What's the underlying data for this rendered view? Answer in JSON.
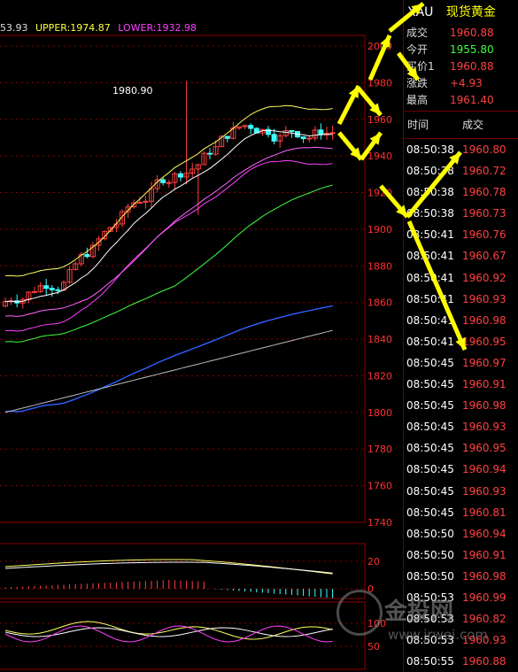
{
  "indicator": {
    "mid_value": "53.93",
    "upper_label": "UPPER:1974.87",
    "lower_label": "LOWER:1932.98",
    "upper_color": "#ffff40",
    "lower_color": "#ff40ff"
  },
  "chart": {
    "high_label": "1980.90",
    "price_axis": [
      "2000",
      "1980",
      "1960",
      "1940",
      "1920",
      "1900",
      "1880",
      "1860",
      "1840",
      "1820",
      "1800",
      "1780",
      "1760",
      "1740"
    ],
    "macd_axis": [
      "20",
      "0"
    ],
    "kdj_axis": [
      "100",
      "50"
    ],
    "colors": {
      "grid": "#8b0000",
      "up": "#ff4040",
      "down": "#40ffff",
      "axis_text": "#ff3030",
      "arrow": "#ffff00"
    }
  },
  "quote": {
    "symbol": "XAU",
    "name": "现货黄金",
    "rows": [
      {
        "label": "成交",
        "value": "1960.88",
        "color": "#ff4040"
      },
      {
        "label": "今开",
        "value": "1955.80",
        "color": "#40ff40"
      },
      {
        "label": "买价1",
        "value": "1960.88",
        "color": "#ff4040"
      },
      {
        "label": "涨跌",
        "value": "+4.93",
        "color": "#ff4040"
      },
      {
        "label": "最高",
        "value": "1961.40",
        "color": "#ff4040"
      }
    ]
  },
  "ticks": {
    "header_time": "时间",
    "header_price": "成交",
    "rows": [
      {
        "time": "08:50:38",
        "price": "1960.80"
      },
      {
        "time": "08:50:38",
        "price": "1960.72"
      },
      {
        "time": "08:50:38",
        "price": "1960.78"
      },
      {
        "time": "08:50:38",
        "price": "1960.73"
      },
      {
        "time": "08:50:41",
        "price": "1960.76"
      },
      {
        "time": "08:50:41",
        "price": "1960.67"
      },
      {
        "time": "08:50:41",
        "price": "1960.92"
      },
      {
        "time": "08:50:41",
        "price": "1960.93"
      },
      {
        "time": "08:50:41",
        "price": "1960.98"
      },
      {
        "time": "08:50:41",
        "price": "1960.95"
      },
      {
        "time": "08:50:45",
        "price": "1960.97"
      },
      {
        "time": "08:50:45",
        "price": "1960.91"
      },
      {
        "time": "08:50:45",
        "price": "1960.98"
      },
      {
        "time": "08:50:45",
        "price": "1960.93"
      },
      {
        "time": "08:50:45",
        "price": "1960.95"
      },
      {
        "time": "08:50:45",
        "price": "1960.94"
      },
      {
        "time": "08:50:45",
        "price": "1960.93"
      },
      {
        "time": "08:50:45",
        "price": "1960.81"
      },
      {
        "time": "08:50:50",
        "price": "1960.94"
      },
      {
        "time": "08:50:50",
        "price": "1960.91"
      },
      {
        "time": "08:50:50",
        "price": "1960.98"
      },
      {
        "time": "08:50:53",
        "price": "1960.99"
      },
      {
        "time": "08:50:53",
        "price": "1960.82"
      },
      {
        "time": "08:50:53",
        "price": "1960.93"
      },
      {
        "time": "08:50:55",
        "price": "1960.88"
      }
    ]
  },
  "watermark": {
    "text": "金投网",
    "url": "www.jrwei.com"
  }
}
